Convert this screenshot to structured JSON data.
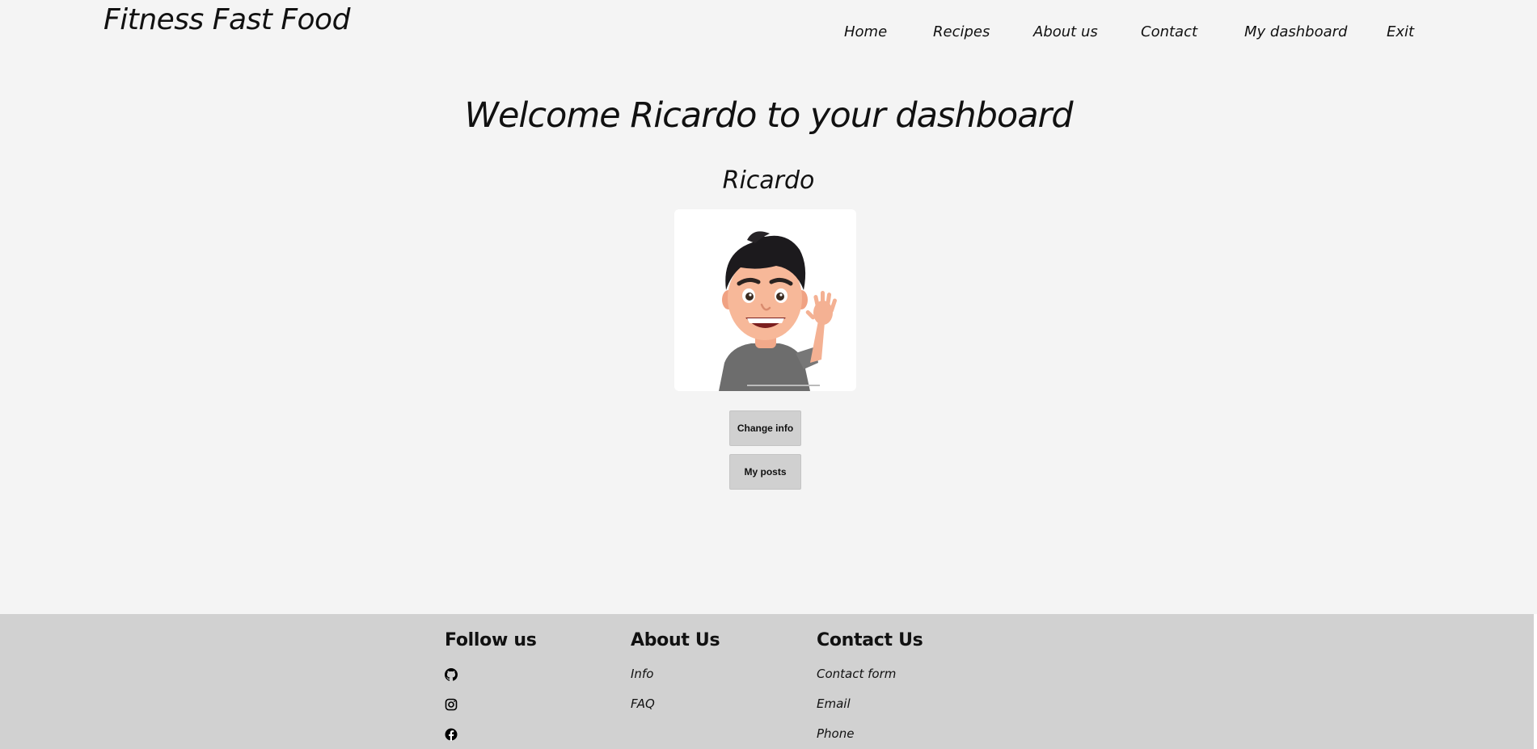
{
  "header": {
    "site_title": "Fitness Fast Food",
    "nav": [
      "Home",
      "Recipes",
      "About us",
      "Contact",
      "My dashboard",
      "Exit"
    ]
  },
  "main": {
    "welcome": "Welcome Ricardo to your dashboard",
    "username": "Ricardo",
    "avatar_icon": "memoji-avatar-waving",
    "buttons": {
      "change_info": "Change info",
      "my_posts": "My posts"
    }
  },
  "footer": {
    "follow": {
      "title": "Follow us",
      "icons": [
        "github-icon",
        "instagram-icon",
        "facebook-icon"
      ]
    },
    "about": {
      "title": "About Us",
      "links": [
        "Info",
        "FAQ"
      ]
    },
    "contact": {
      "title": "Contact Us",
      "links": [
        "Contact form",
        "Email",
        "Phone"
      ]
    }
  },
  "colors": {
    "page_bg": "#f4f4f4",
    "footer_bg": "#d1d1d1",
    "button_bg": "#d0d0d0"
  }
}
